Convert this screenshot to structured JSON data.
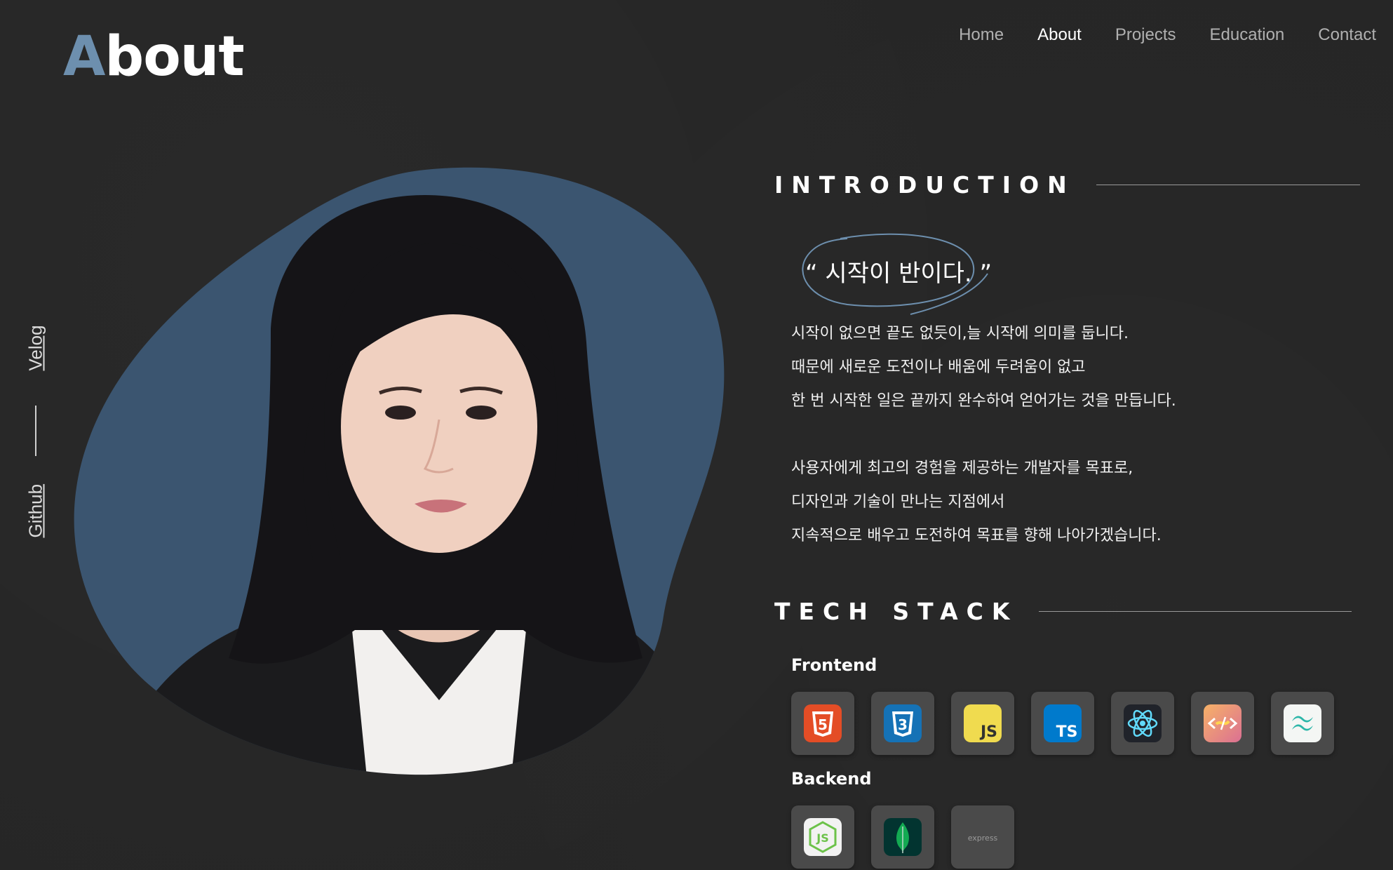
{
  "header": {
    "title_first_letter": "A",
    "title_rest": "bout",
    "nav": [
      {
        "label": "Home",
        "active": false
      },
      {
        "label": "About",
        "active": true
      },
      {
        "label": "Projects",
        "active": false
      },
      {
        "label": "Education",
        "active": false
      },
      {
        "label": "Contact",
        "active": false
      }
    ]
  },
  "social": {
    "velog": "Velog",
    "github": "Github"
  },
  "portrait": {
    "blob_color": "#3b5570",
    "icon": "profile-photo"
  },
  "introduction": {
    "heading": "INTRODUCTION",
    "quote": "“ 시작이 반이다. ”",
    "paragraph1": [
      "시작이 없으면 끝도 없듯이,늘 시작에 의미를 둡니다.",
      "때문에 새로운 도전이나 배움에 두려움이 없고",
      "한 번 시작한 일은 끝까지 완수하여 얻어가는 것을 만듭니다."
    ],
    "paragraph2": [
      "사용자에게 최고의 경험을 제공하는 개발자를 목표로,",
      "디자인과 기술이 만나는 지점에서",
      "지속적으로 배우고 도전하여 목표를 향해 나아가겠습니다."
    ]
  },
  "tech_stack": {
    "heading": "TECH STACK",
    "frontend_label": "Frontend",
    "backend_label": "Backend",
    "frontend": [
      {
        "icon": "html5-icon",
        "label": "5"
      },
      {
        "icon": "css3-icon",
        "label": "3"
      },
      {
        "icon": "javascript-icon",
        "label": "JS"
      },
      {
        "icon": "typescript-icon",
        "label": "TS"
      },
      {
        "icon": "react-icon",
        "label": ""
      },
      {
        "icon": "styled-components-icon",
        "label": ""
      },
      {
        "icon": "tailwind-icon",
        "label": ""
      }
    ],
    "backend": [
      {
        "icon": "nodejs-icon",
        "label": "JS"
      },
      {
        "icon": "mongodb-icon",
        "label": ""
      },
      {
        "icon": "express-icon",
        "label": "express"
      }
    ]
  },
  "colors": {
    "background": "#262626",
    "accent": "#6d8fae",
    "tile": "#4a4a4a"
  }
}
